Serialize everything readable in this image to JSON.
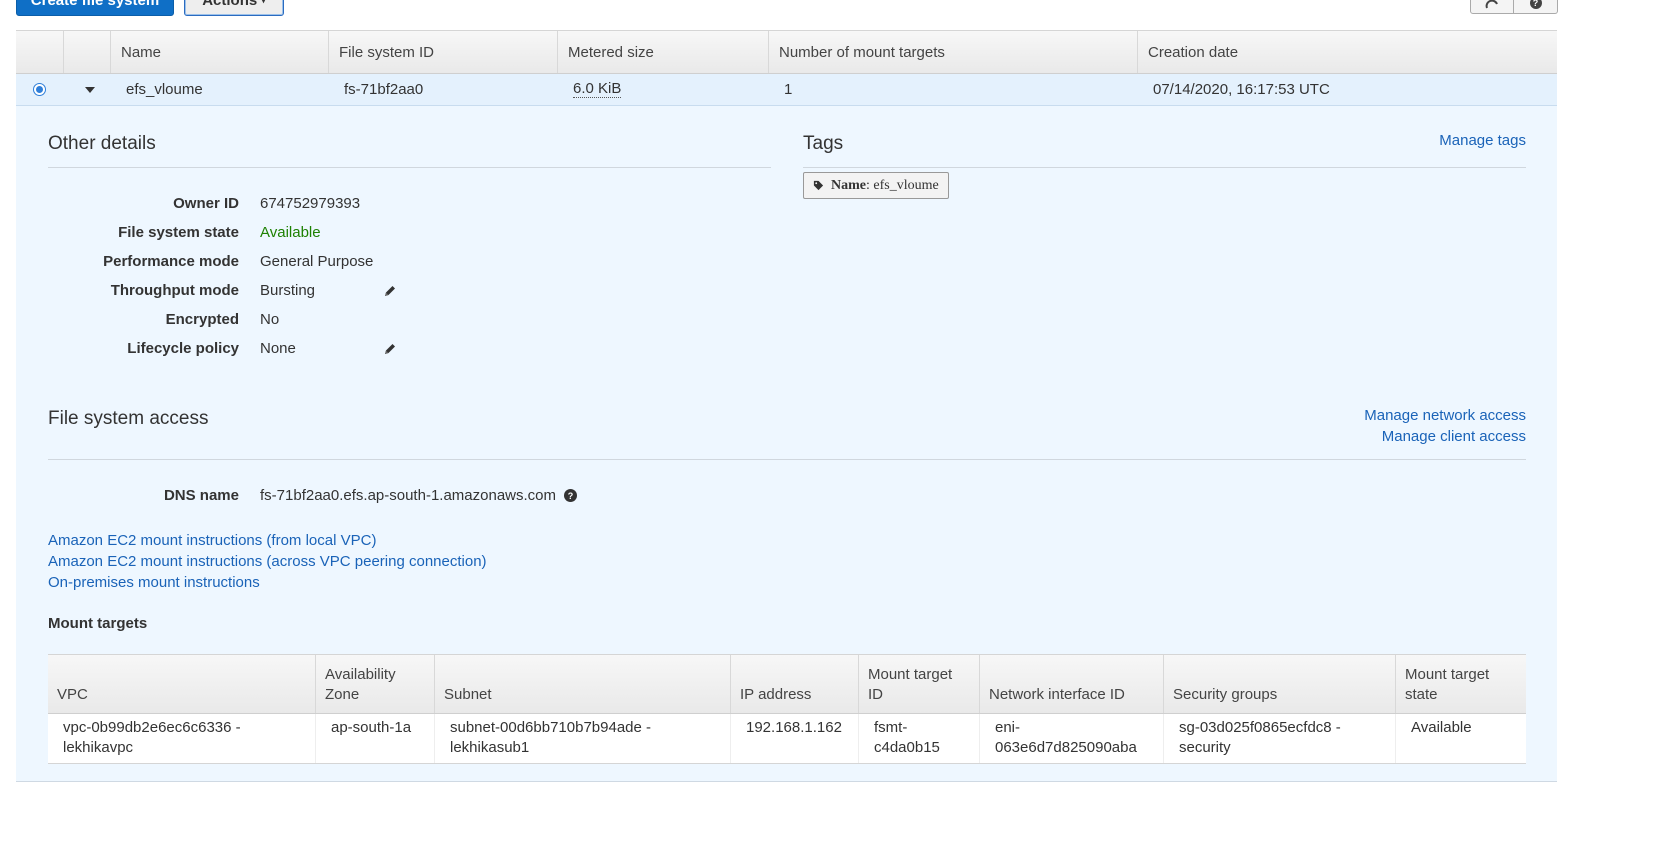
{
  "toolbar": {
    "create_label": "Create file system",
    "actions_label": "Actions",
    "actions_caret": "▾"
  },
  "table": {
    "headers": [
      "",
      "",
      "Name",
      "File system ID",
      "Metered size",
      "Number of mount targets",
      "Creation date"
    ],
    "row": {
      "name": "efs_vloume",
      "id": "fs-71bf2aa0",
      "size": "6.0 KiB",
      "mount_targets": "1",
      "created": "07/14/2020, 16:17:53 UTC"
    }
  },
  "other_details": {
    "title": "Other details",
    "fields": [
      {
        "label": "Owner ID",
        "value": "674752979393"
      },
      {
        "label": "File system state",
        "value": "Available"
      },
      {
        "label": "Performance mode",
        "value": "General Purpose"
      },
      {
        "label": "Throughput mode",
        "value": "Bursting"
      },
      {
        "label": "Encrypted",
        "value": "No"
      },
      {
        "label": "Lifecycle policy",
        "value": "None"
      }
    ]
  },
  "tags": {
    "title": "Tags",
    "manage_label": "Manage tags",
    "tag_key": "Name",
    "tag_sep": ":",
    "tag_value": "efs_vloume"
  },
  "access": {
    "title": "File system access",
    "manage_network": "Manage network access",
    "manage_client": "Manage client access",
    "dns_label": "DNS name",
    "dns_value": "fs-71bf2aa0.efs.ap-south-1.amazonaws.com",
    "links": [
      "Amazon EC2 mount instructions (from local VPC)",
      "Amazon EC2 mount instructions (across VPC peering connection)",
      "On-premises mount instructions"
    ]
  },
  "mount_targets": {
    "title": "Mount targets",
    "headers": [
      [
        "VPC"
      ],
      [
        "Availability",
        "Zone"
      ],
      [
        "Subnet"
      ],
      [
        "IP address"
      ],
      [
        "Mount target ID"
      ],
      [
        "Network interface ID"
      ],
      [
        "Security groups"
      ],
      [
        "Mount target",
        "state"
      ]
    ],
    "row": [
      [
        "vpc-0b99db2e6ec6c6336 -",
        "lekhikavpc"
      ],
      [
        "ap-south-1a"
      ],
      [
        "subnet-00d6bb710b7b94ade -",
        "lekhikasub1"
      ],
      [
        "192.168.1.162"
      ],
      [
        "fsmt-",
        "c4da0b15"
      ],
      [
        "eni-",
        "063e6d7d825090aba"
      ],
      [
        "sg-03d025f0865ecfdc8 -",
        "security"
      ],
      [
        "Available"
      ]
    ]
  },
  "colors": {
    "primary": "#0f6fc6",
    "link": "#1a63b8",
    "available": "#1d8102",
    "selected_row": "#e4f1fd",
    "panel": "#eef7ff"
  }
}
